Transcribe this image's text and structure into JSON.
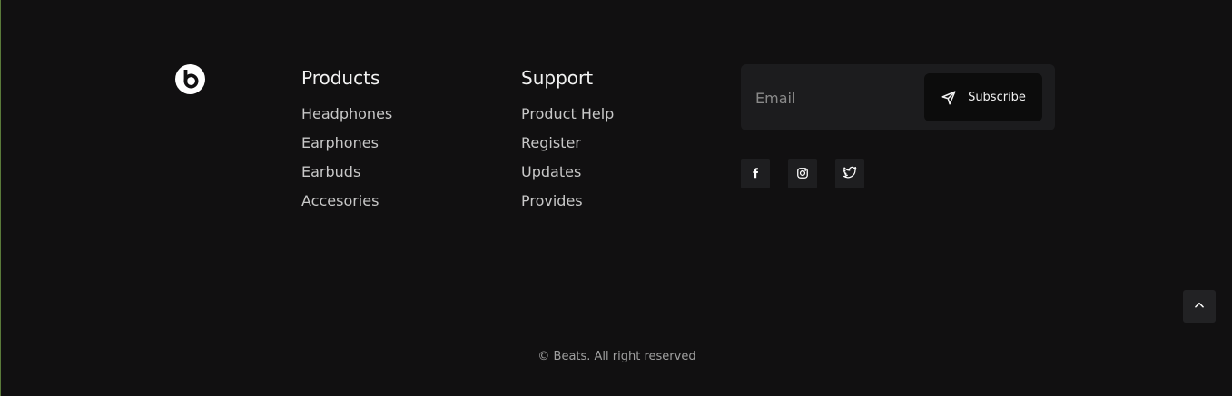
{
  "brand": {
    "logo_icon": "beats-logo-icon"
  },
  "products": {
    "heading": "Products",
    "items": [
      "Headphones",
      "Earphones",
      "Earbuds",
      "Accesories"
    ]
  },
  "support": {
    "heading": "Support",
    "items": [
      "Product Help",
      "Register",
      "Updates",
      "Provides"
    ]
  },
  "newsletter": {
    "email_placeholder": "Email",
    "email_value": "",
    "subscribe_label": "Subscribe",
    "subscribe_icon": "send-icon"
  },
  "social": {
    "facebook_icon": "facebook-icon",
    "instagram_icon": "instagram-icon",
    "twitter_icon": "twitter-icon"
  },
  "scroll_top_icon": "chevron-up-icon",
  "footer": {
    "copyright": "© Beats. All right reserved"
  },
  "colors": {
    "background": "#111011",
    "panel": "#1c1c1e",
    "button": "#0c0c0c",
    "text": "#f2f2f2",
    "muted_text": "#c8c8c8"
  }
}
